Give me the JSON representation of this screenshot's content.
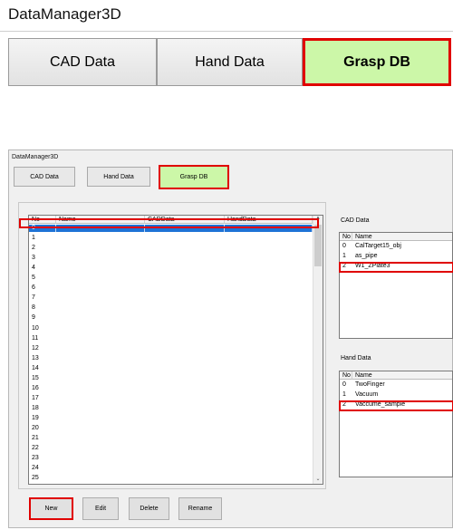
{
  "app": {
    "title": "DataManager3D",
    "tabs": [
      {
        "label": "CAD Data",
        "active": false
      },
      {
        "label": "Hand Data",
        "active": false
      },
      {
        "label": "Grasp DB",
        "active": true
      }
    ]
  },
  "grasp_list": {
    "columns": [
      "No",
      "Name",
      "CADData",
      "HandData"
    ],
    "rows": [
      "0",
      "1",
      "2",
      "3",
      "4",
      "5",
      "6",
      "7",
      "8",
      "9",
      "10",
      "11",
      "12",
      "13",
      "14",
      "15",
      "16",
      "17",
      "18",
      "19",
      "20",
      "21",
      "22",
      "23",
      "24",
      "25"
    ],
    "selected_row": "0",
    "scroll_up": "▲",
    "scroll_down": "⌄"
  },
  "cad_data": {
    "label": "CAD Data",
    "columns": [
      "No",
      "Name"
    ],
    "rows": [
      {
        "no": "0",
        "name": "CalTarget15_obj"
      },
      {
        "no": "1",
        "name": "as_pipe"
      },
      {
        "no": "2",
        "name": "W1_ZPlate3"
      }
    ],
    "selected_row": "2"
  },
  "hand_data": {
    "label": "Hand Data",
    "columns": [
      "No",
      "Name"
    ],
    "rows": [
      {
        "no": "0",
        "name": "TwoFinger"
      },
      {
        "no": "1",
        "name": "Vacuum"
      },
      {
        "no": "2",
        "name": "Vaccume_sample"
      }
    ],
    "selected_row": "2"
  },
  "buttons": {
    "new": "New",
    "edit": "Edit",
    "delete": "Delete",
    "rename": "Rename"
  },
  "colors": {
    "active_tab": "#ccf7a8",
    "highlight": "#e00000",
    "selection": "#1e73d6"
  }
}
